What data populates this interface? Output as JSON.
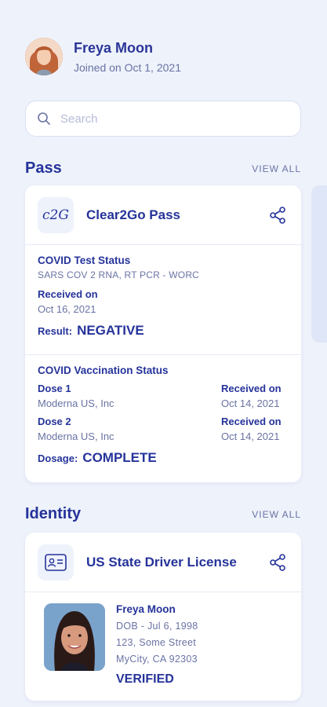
{
  "profile": {
    "name": "Freya Moon",
    "joined": "Joined on Oct 1, 2021"
  },
  "search": {
    "placeholder": "Search",
    "value": ""
  },
  "pass_section": {
    "title": "Pass",
    "view_all": "VIEW ALL"
  },
  "pass_card": {
    "logo_text": "c2G",
    "title": "Clear2Go Pass",
    "covid_test": {
      "title": "COVID Test Status",
      "subtitle": "SARS COV 2 RNA, RT PCR - WORC",
      "received_label": "Received on",
      "received_date": "Oct 16, 2021",
      "result_label": "Result:",
      "result_value": "NEGATIVE"
    },
    "vaccination": {
      "title": "COVID Vaccination Status",
      "doses": [
        {
          "name": "Dose 1",
          "maker": "Moderna US, Inc",
          "received_label": "Received on",
          "received_date": "Oct 14, 2021"
        },
        {
          "name": "Dose 2",
          "maker": "Moderna US, Inc",
          "received_label": "Received on",
          "received_date": "Oct 14, 2021"
        }
      ],
      "dosage_label": "Dosage:",
      "dosage_value": "COMPLETE"
    }
  },
  "identity_section": {
    "title": "Identity",
    "view_all": "VIEW ALL"
  },
  "identity_card": {
    "title": "US State Driver License",
    "name": "Freya Moon",
    "dob": "DOB - Jul 6, 1998",
    "address_line1": "123, Some Street",
    "address_line2": "MyCity, CA 92303",
    "status": "VERIFIED"
  },
  "icons": {
    "search": "search-icon",
    "share": "share-icon",
    "id_card": "id-card-icon"
  },
  "colors": {
    "background": "#eef2fb",
    "accent": "#25339a",
    "muted": "#6a73a4"
  }
}
